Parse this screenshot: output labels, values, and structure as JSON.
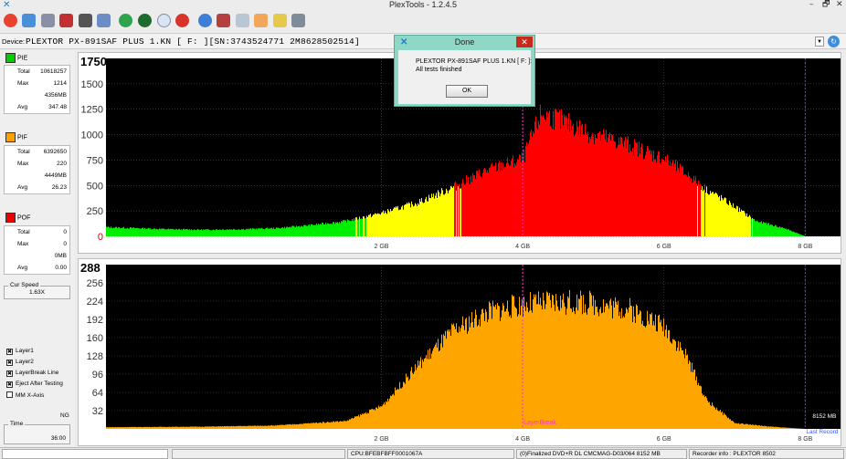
{
  "window": {
    "title": "PlexTools - 1.2.4.5",
    "minimize": "–",
    "restore": "🗗",
    "close": "✕"
  },
  "toolbar": {
    "icons": [
      "power-icon",
      "tools-icon",
      "drive-icon",
      "eject-disc-icon",
      "disc-icon",
      "layers-icon",
      "refresh-icon",
      "test-icon",
      "settings-icon",
      "stop-icon",
      "record-icon",
      "scan-icon",
      "print-icon",
      "hand-icon",
      "edit-icon",
      "save-icon"
    ]
  },
  "device": {
    "label": "Device:",
    "value": "PLEXTOR  PX-891SAF PLUS   1.KN [ F: ][SN:3743524771 2M8628502514]",
    "dropdown": "▼",
    "refresh": "↻"
  },
  "pie": {
    "header": "PIE",
    "color": "#00cc00",
    "total_label": "Total",
    "total": "10618257",
    "max_label": "Max",
    "max": "1214",
    "size": "4356MB",
    "avg_label": "Avg",
    "avg": "347.48"
  },
  "pif": {
    "header": "PIF",
    "color": "#ffa000",
    "total_label": "Total",
    "total": "6392650",
    "max_label": "Max",
    "max": "220",
    "size": "4449MB",
    "avg_label": "Avg",
    "avg": "26.23"
  },
  "pof": {
    "header": "POF",
    "color": "#ee0000",
    "total_label": "Total",
    "total": "0",
    "max_label": "Max",
    "max": "0",
    "size": "0MB",
    "avg_label": "Avg",
    "avg": "0.00"
  },
  "cur_speed": {
    "label": "Cur Speed",
    "value": "1.63X"
  },
  "options": {
    "layer1": "Layer1",
    "layer2": "Layer2",
    "layerbreak": "LayerBreak Line",
    "eject": "Eject After Testing",
    "mm": "MM X-Axis",
    "check": "✖",
    "ng": "NG"
  },
  "time": {
    "label": "Time",
    "value": "36:00"
  },
  "dialog": {
    "title": "Done",
    "line1": "PLEXTOR  PX-891SAF PLUS   1.KN [ F: ]:",
    "line2": "All tests finished",
    "ok": "OK",
    "close": "✕"
  },
  "chart_data": [
    {
      "type": "area",
      "y_top_label": "1750",
      "ylim": [
        0,
        1750
      ],
      "yticks": [
        0,
        250,
        500,
        750,
        1000,
        1250,
        1500
      ],
      "xticks": [
        "2 GB",
        "4 GB",
        "6 GB",
        "8 GB"
      ],
      "xlim_gb": [
        -1.9,
        8.5
      ],
      "layer_break_gb": 4.0,
      "end_gb": 8.0,
      "colors": {
        "low": "#00ee00",
        "mid": "#ffff00",
        "high": "#ff0000"
      },
      "x": [
        -1.9,
        -1.0,
        -0.5,
        0.0,
        0.5,
        1.0,
        1.5,
        2.0,
        2.5,
        3.0,
        3.5,
        4.0,
        4.25,
        4.5,
        5.0,
        5.5,
        6.0,
        6.3,
        6.6,
        7.0,
        7.3,
        7.7,
        8.0
      ],
      "values": [
        90,
        70,
        65,
        70,
        80,
        110,
        150,
        230,
        330,
        480,
        650,
        760,
        1200,
        1150,
        1000,
        900,
        760,
        620,
        460,
        290,
        150,
        80,
        0
      ]
    },
    {
      "type": "area",
      "y_top_label": "288",
      "ylim": [
        0,
        288
      ],
      "yticks": [
        32,
        64,
        96,
        128,
        160,
        192,
        224,
        256
      ],
      "xticks": [
        "2 GB",
        "4 GB",
        "6 GB",
        "8 GB"
      ],
      "xlim_gb": [
        -1.9,
        8.5
      ],
      "layer_break_gb": 4.0,
      "end_gb": 8.0,
      "color": "#ffa500",
      "layerbreak_label": "LayerBreak",
      "end_label": "8152 MB",
      "end_label2": "Last Record",
      "x": [
        -1.9,
        -0.5,
        0.5,
        1.5,
        2.0,
        2.5,
        3.0,
        3.5,
        4.0,
        4.5,
        5.0,
        5.5,
        6.0,
        6.3,
        6.6,
        7.0,
        7.5,
        8.0
      ],
      "values": [
        3,
        4,
        6,
        14,
        40,
        110,
        170,
        205,
        218,
        222,
        220,
        210,
        180,
        130,
        50,
        10,
        4,
        0
      ]
    }
  ],
  "status": {
    "p1": "",
    "p2": "",
    "cpu": "CPU:BFEBFBFF0001067A",
    "disc": "(0)Finalized  DVD+R DL  CMCMAG-D03/064  8152 MB",
    "recorder": "Recorder info : PLEXTOR      8502"
  }
}
